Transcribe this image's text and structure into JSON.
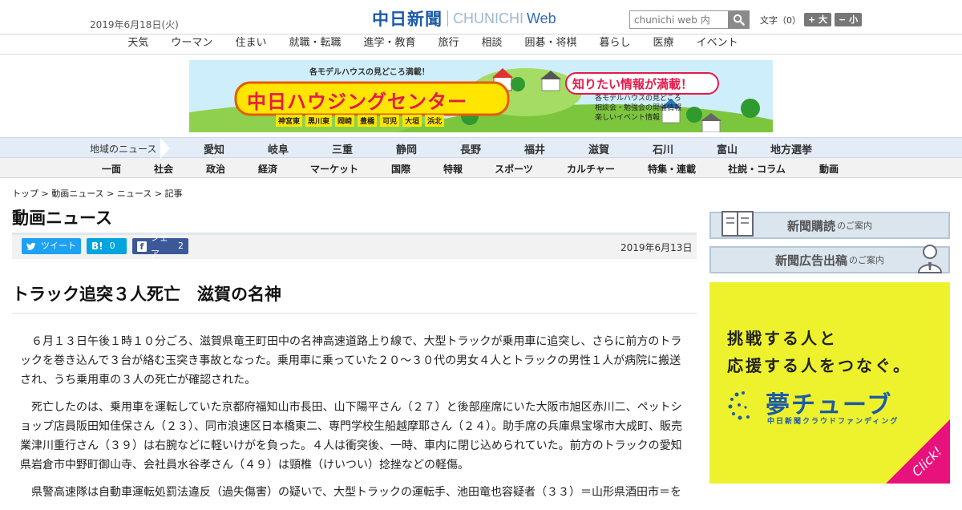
{
  "header": {
    "date": "2019年6月18日(火)",
    "logo_jp": "中日新聞",
    "logo_en": "CHUNICHI",
    "logo_web": "Web",
    "search_placeholder": "chunichi web 内",
    "font_label": "文字（0）",
    "font_larger": "+ 大",
    "font_smaller": "− 小"
  },
  "global_nav": [
    "天気",
    "ウーマン",
    "住まい",
    "就職・転職",
    "進学・教育",
    "旅行",
    "相談",
    "囲碁・将棋",
    "暮らし",
    "医療",
    "イベント"
  ],
  "banner": {
    "top_text": "各モデルハウスの見どころ満載！",
    "main_text": "中日ハウジングセンター",
    "bubble": "知りたい情報が満載！",
    "places": [
      "神宮東",
      "黒川東",
      "岡崎",
      "豊橋",
      "可児",
      "大垣",
      "浜北"
    ],
    "bullets": [
      "各モデルハウスの見どころ",
      "相談会・勉強会の開催情報",
      "楽しいイベント情報"
    ]
  },
  "region_nav": {
    "label": "地域のニュース",
    "items": [
      "愛知",
      "岐阜",
      "三重",
      "静岡",
      "長野",
      "福井",
      "滋賀",
      "石川",
      "富山",
      "地方選挙"
    ]
  },
  "category_nav": [
    "一面",
    "社会",
    "政治",
    "経済",
    "マーケット",
    "国際",
    "特報",
    "スポーツ",
    "カルチャー",
    "特集・連載",
    "社説・コラム",
    "動画"
  ],
  "breadcrumb": "トップ > 動画ニュース > ニュース > 記事",
  "section_title": "動画ニュース",
  "share": {
    "tweet": "ツイート",
    "hatena_count": "0",
    "facebook": "シェア",
    "facebook_count": "2"
  },
  "published_date": "2019年6月13日",
  "headline": "トラック追突３人死亡　滋賀の名神",
  "paragraphs": [
    "６月１３日午後１時１０分ごろ、滋賀県竜王町田中の名神高速道路上り線で、大型トラックが乗用車に追突し、さらに前方のトラックを巻き込んで３台が絡む玉突き事故となった。乗用車に乗っていた２０～３０代の男女４人とトラックの男性１人が病院に搬送され、うち乗用車の３人の死亡が確認された。",
    "死亡したのは、乗用車を運転していた京都府福知山市長田、山下陽平さん（２７）と後部座席にいた大阪市旭区赤川二、ペットショップ店員阪田知佳保さん（２３）、同市浪速区日本橋東二、専門学校生船越摩耶さん（２４）。助手席の兵庫県宝塚市大成町、販売業津川重行さん（３９）は右腕などに軽いけがを負った。４人は衝突後、一時、車内に閉じ込められていた。前方のトラックの愛知県岩倉市中野町御山寺、会社員水谷孝さん（４９）は頸椎（けいつい）捻挫などの軽傷。",
    "県警高速隊は自動車運転処罰法違反（過失傷害）の疑いで、大型トラックの運転手、池田竜也容疑者（３３）＝山形県酒田市＝を"
  ],
  "sidebar": {
    "subscribe_main": "新聞購読",
    "subscribe_sub": "のご案内",
    "ad_main": "新聞広告出稿",
    "ad_sub": "のご案内"
  },
  "ad": {
    "line1": "挑戦する人と",
    "line2": "応援する人をつなぐ。",
    "brand": "夢チューブ",
    "brand_sub": "中日新聞クラウドファンディング",
    "click": "Click!"
  },
  "colors": {
    "logo_blue": "#1c5aa8",
    "twitter": "#1da1f2",
    "hatena": "#00a4de",
    "facebook": "#3b5998",
    "ad_yellow": "#eef22c",
    "click_pink": "#e8127d",
    "region_bar": "#e4ecf7"
  }
}
